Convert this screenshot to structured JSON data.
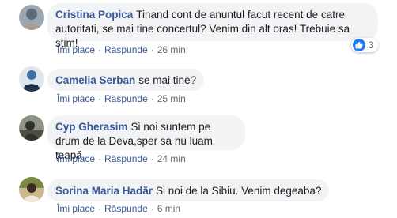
{
  "comments": [
    {
      "author": "Cristina Popica",
      "text": "Tinand cont de anuntul facut recent de catre autoritati, se mai tine concertul? Venim din alt oras! Trebuie sa stim!",
      "like_label": "Îmi place",
      "reply_label": "Răspunde",
      "time": "26 min",
      "reaction_count": "3",
      "reaction_icon": "like-icon",
      "avatar_colors": [
        "#5b6b7a",
        "#a89f94"
      ]
    },
    {
      "author": "Camelia Serban",
      "text": "se mai tine?",
      "like_label": "Îmi place",
      "reply_label": "Răspunde",
      "time": "25 min",
      "avatar_colors": [
        "#3f6fa3",
        "#22354f"
      ]
    },
    {
      "author": "Cyp Gherasim",
      "text": "Si noi suntem pe drum de la Deva,sper sa nu luam țeapă.",
      "like_label": "Îmi place",
      "reply_label": "Răspunde",
      "time": "24 min",
      "avatar_colors": [
        "#4b4f46",
        "#8d9486"
      ]
    },
    {
      "author": "Sorina Maria Hadăr",
      "text": "Si noi de la Sibiu. Venim degeaba?",
      "like_label": "Îmi place",
      "reply_label": "Răspunde",
      "time": "6 min",
      "avatar_colors": [
        "#7a8a45",
        "#c9b98c"
      ]
    }
  ],
  "colors": {
    "author": "#385898",
    "bubble": "#f2f3f5",
    "like_badge": "#2078f4",
    "meta": "#606770"
  }
}
